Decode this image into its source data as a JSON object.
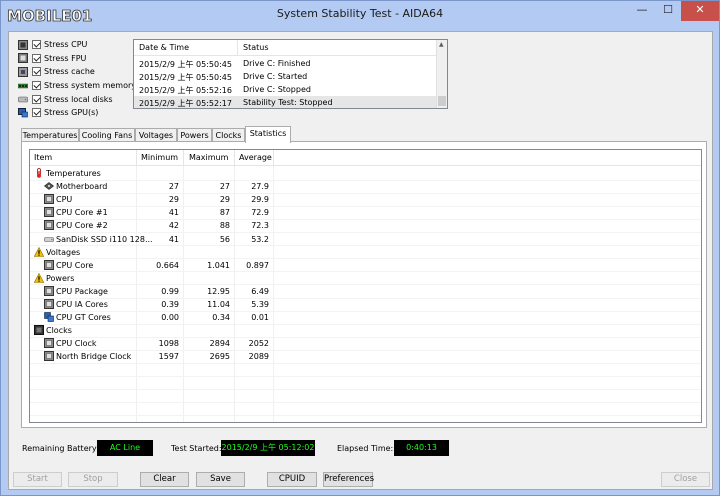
{
  "window": {
    "title": "System Stability Test - AIDA64",
    "logo_text": "MOBILE01",
    "minimize_glyph": "—",
    "maximize_glyph": "☐",
    "close_glyph": "✕"
  },
  "stress_options": [
    {
      "label": "Stress CPU",
      "icon": "cpu-chip-icon",
      "checked": true
    },
    {
      "label": "Stress FPU",
      "icon": "fpu-chip-icon",
      "checked": true
    },
    {
      "label": "Stress cache",
      "icon": "cache-chip-icon",
      "checked": true
    },
    {
      "label": "Stress system memory",
      "icon": "memory-module-icon",
      "checked": true
    },
    {
      "label": "Stress local disks",
      "icon": "hard-disk-icon",
      "checked": true
    },
    {
      "label": "Stress GPU(s)",
      "icon": "monitor-icon",
      "checked": true
    }
  ],
  "log": {
    "columns": [
      "Date & Time",
      "Status"
    ],
    "rows": [
      {
        "datetime": "2015/2/9 上午 05:50:45",
        "status": "Drive C: Finished"
      },
      {
        "datetime": "2015/2/9 上午 05:50:45",
        "status": "Drive C: Started"
      },
      {
        "datetime": "2015/2/9 上午 05:52:16",
        "status": "Drive C: Stopped"
      },
      {
        "datetime": "2015/2/9 上午 05:52:17",
        "status": "Stability Test: Stopped"
      }
    ]
  },
  "tabs": [
    {
      "label": "Temperatures",
      "active": false
    },
    {
      "label": "Cooling Fans",
      "active": false
    },
    {
      "label": "Voltages",
      "active": false
    },
    {
      "label": "Powers",
      "active": false
    },
    {
      "label": "Clocks",
      "active": false
    },
    {
      "label": "Statistics",
      "active": true
    }
  ],
  "statistics": {
    "columns": [
      "Item",
      "Minimum",
      "Maximum",
      "Average"
    ],
    "rows": [
      {
        "type": "group",
        "name": "Temperatures",
        "icon": "thermometer-icon"
      },
      {
        "type": "item",
        "name": "Motherboard",
        "icon": "motherboard-icon",
        "min": "27",
        "max": "27",
        "avg": "27.9"
      },
      {
        "type": "item",
        "name": "CPU",
        "icon": "cpu-icon",
        "min": "29",
        "max": "29",
        "avg": "29.9"
      },
      {
        "type": "item",
        "name": "CPU Core #1",
        "icon": "cpu-icon",
        "min": "41",
        "max": "87",
        "avg": "72.9"
      },
      {
        "type": "item",
        "name": "CPU Core #2",
        "icon": "cpu-icon",
        "min": "42",
        "max": "88",
        "avg": "72.3"
      },
      {
        "type": "item",
        "name": "SanDisk SSD i110 128...",
        "icon": "disk-drive-icon",
        "min": "41",
        "max": "56",
        "avg": "53.2"
      },
      {
        "type": "group",
        "name": "Voltages",
        "icon": "warning-icon"
      },
      {
        "type": "item",
        "name": "CPU Core",
        "icon": "cpu-icon",
        "min": "0.664",
        "max": "1.041",
        "avg": "0.897"
      },
      {
        "type": "group",
        "name": "Powers",
        "icon": "warning-icon"
      },
      {
        "type": "item",
        "name": "CPU Package",
        "icon": "cpu-icon",
        "min": "0.99",
        "max": "12.95",
        "avg": "6.49"
      },
      {
        "type": "item",
        "name": "CPU IA Cores",
        "icon": "cpu-icon",
        "min": "0.39",
        "max": "11.04",
        "avg": "5.39"
      },
      {
        "type": "item",
        "name": "CPU GT Cores",
        "icon": "gpu-icon",
        "min": "0.00",
        "max": "0.34",
        "avg": "0.01"
      },
      {
        "type": "group",
        "name": "Clocks",
        "icon": "clock-chip-icon"
      },
      {
        "type": "item",
        "name": "CPU Clock",
        "icon": "cpu-icon",
        "min": "1098",
        "max": "2894",
        "avg": "2052"
      },
      {
        "type": "item",
        "name": "North Bridge Clock",
        "icon": "cpu-icon",
        "min": "1597",
        "max": "2695",
        "avg": "2089"
      }
    ]
  },
  "status": {
    "remaining_battery_label": "Remaining Battery:",
    "remaining_battery_value": "AC Line",
    "test_started_label": "Test Started:",
    "test_started_value": "2015/2/9 上午 05:12:02",
    "elapsed_time_label": "Elapsed Time:",
    "elapsed_time_value": "0:40:13"
  },
  "buttons": {
    "start": "Start",
    "stop": "Stop",
    "clear": "Clear",
    "save": "Save",
    "cpuid": "CPUID",
    "preferences": "Preferences",
    "close": "Close"
  },
  "colors": {
    "lcd_text": "#1dff1d",
    "close_button": "#c7504b",
    "title_bar": "#b3cbf3"
  }
}
